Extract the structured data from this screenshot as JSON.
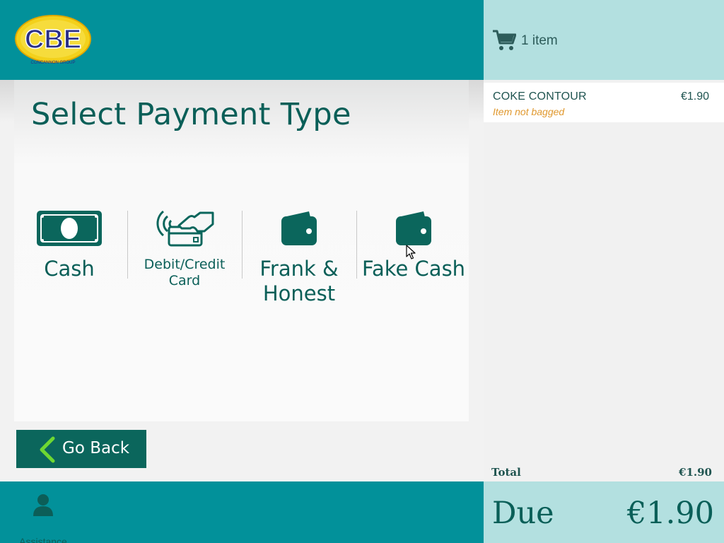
{
  "brand": {
    "logo_text": "CBE",
    "logo_subtext": "CONCANNON GROUP",
    "colors": {
      "teal": "#02919a",
      "light_teal": "#b3e0e0",
      "dark_green": "#0a5f58",
      "logo_blue": "#2a2e86",
      "logo_yellow": "#f3d11b"
    }
  },
  "main": {
    "title": "Select Payment Type",
    "payment_options": [
      {
        "label": "Cash",
        "icon": "banknote-icon"
      },
      {
        "label": "Debit/Credit Card",
        "icon": "contactless-card-icon"
      },
      {
        "label": "Frank & Honest",
        "icon": "wallet-icon"
      },
      {
        "label": "Fake Cash",
        "icon": "wallet-icon"
      }
    ],
    "go_back_label": "Go Back"
  },
  "footer": {
    "assistance_label": "Assistance"
  },
  "cart": {
    "count_label": "1 item",
    "items": [
      {
        "name": "COKE CONTOUR",
        "price": "€1.90",
        "status": "Item not bagged"
      }
    ],
    "total_label": "Total",
    "total_value": "€1.90",
    "due_label": "Due",
    "due_value": "€1.90"
  }
}
